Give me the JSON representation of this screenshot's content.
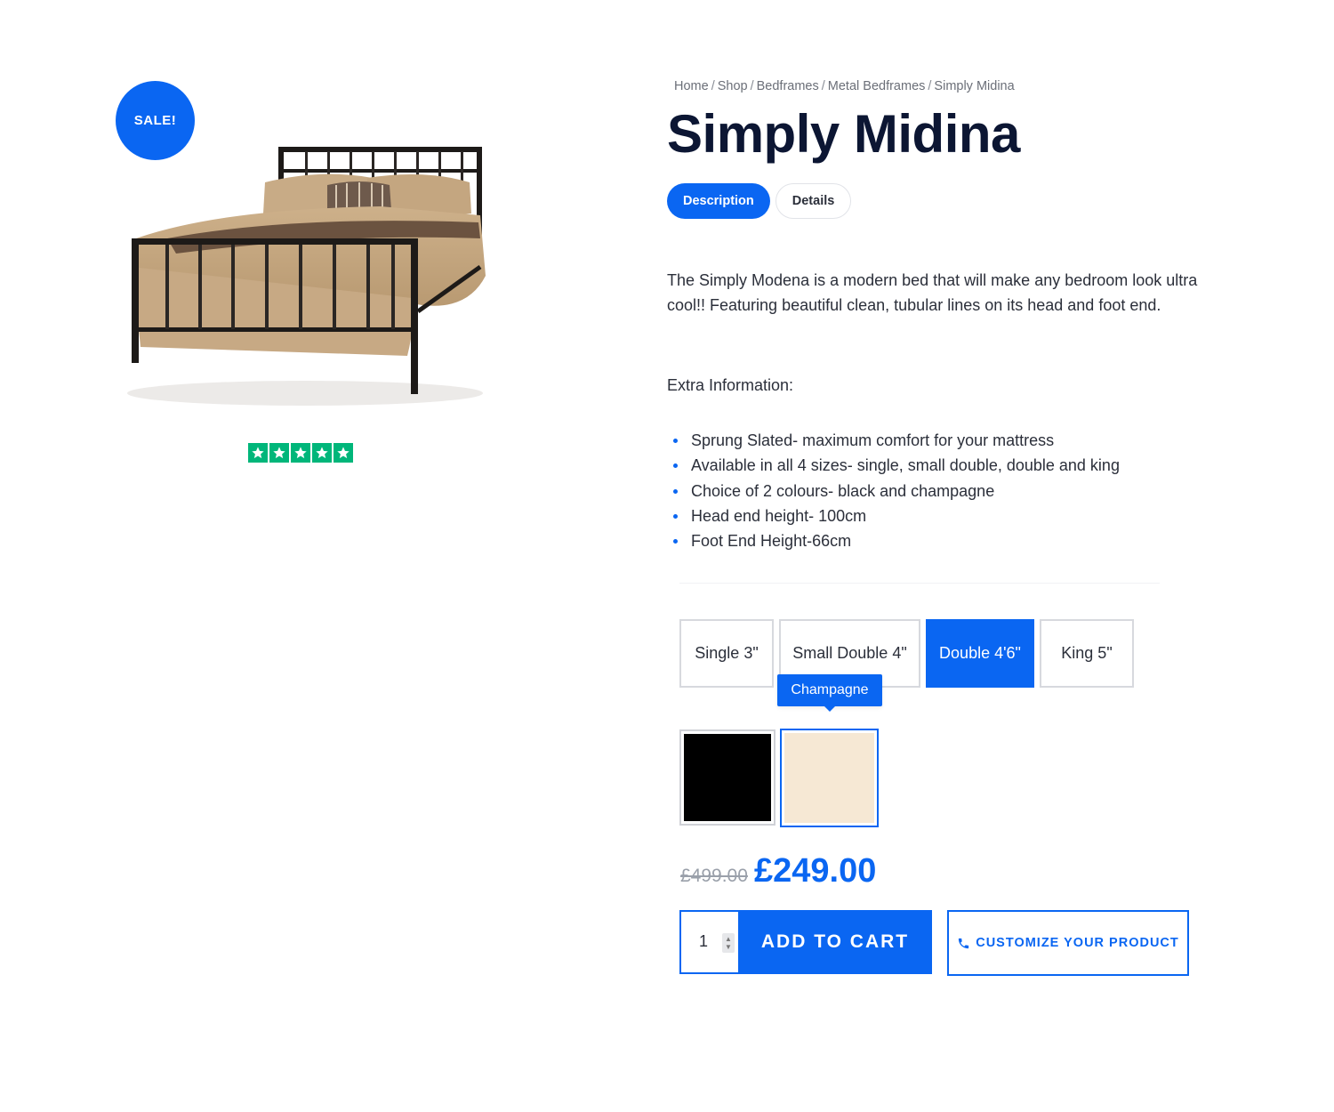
{
  "badge": {
    "sale_label": "SALE!"
  },
  "rating": {
    "stars": 5,
    "max": 5,
    "star_color": "#00b67a"
  },
  "breadcrumb": {
    "items": [
      "Home",
      "Shop",
      "Bedframes",
      "Metal Bedframes",
      "Simply Midina"
    ],
    "separator": "/"
  },
  "product": {
    "title": "Simply Midina",
    "image_icon": "metal-bed-frame-image"
  },
  "tabs": [
    {
      "label": "Description",
      "active": true
    },
    {
      "label": "Details",
      "active": false
    }
  ],
  "description": {
    "text": "The Simply Modena is a modern bed that will make any bedroom look ultra cool!! Featuring beautiful clean, tubular lines on its head and foot end.",
    "extra_title": "Extra Information:",
    "features": [
      "Sprung Slated- maximum comfort for your mattress",
      "Available in all 4 sizes- single, small double, double and king",
      "Choice of 2 colours- black and champagne",
      "Head end height- 100cm",
      "Foot End Height-66cm"
    ]
  },
  "sizes": [
    {
      "label": "Single 3\"",
      "selected": false
    },
    {
      "label": "Small Double 4\"",
      "selected": false
    },
    {
      "label": "Double 4'6\"",
      "selected": true
    },
    {
      "label": "King 5\"",
      "selected": false
    }
  ],
  "colours": {
    "tooltip": "Champagne",
    "options": [
      {
        "name": "Black",
        "hex": "#000000",
        "selected": false
      },
      {
        "name": "Champagne",
        "hex": "#f6e8d4",
        "selected": true
      }
    ]
  },
  "price": {
    "old": "£499.00",
    "current": "£249.00"
  },
  "cart": {
    "quantity": "1",
    "add_label": "ADD TO CART",
    "customize_label": "CUSTOMIZE YOUR PRODUCT",
    "customize_icon": "phone-icon"
  },
  "theme": {
    "accent": "#0a66f2",
    "title_color": "#0c1633"
  }
}
